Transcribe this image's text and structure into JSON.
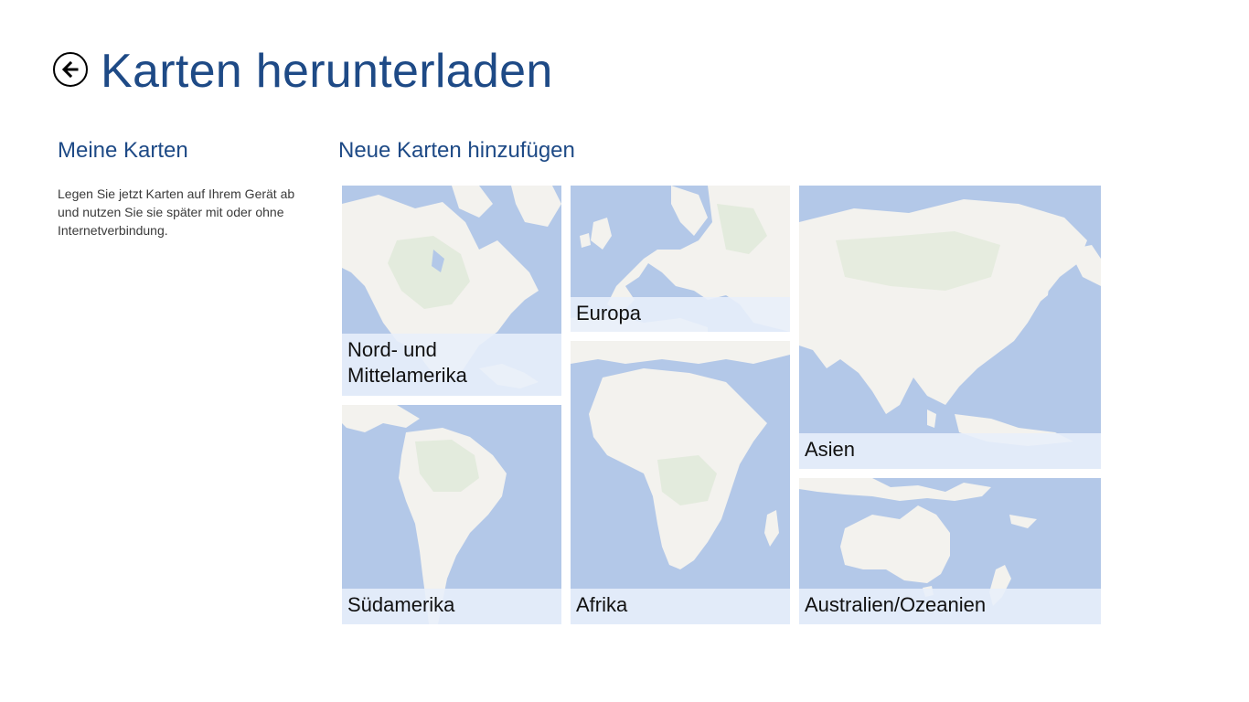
{
  "header": {
    "title": "Karten herunterladen",
    "back_icon": "back-arrow-icon"
  },
  "my_maps": {
    "heading": "Meine Karten",
    "description": "Legen Sie jetzt Karten auf Ihrem Gerät ab und nutzen Sie sie später mit oder ohne Internetverbindung."
  },
  "add_maps": {
    "heading": "Neue Karten hinzufügen",
    "regions": {
      "north_america": "Nord- und Mittelamerika",
      "europe": "Europa",
      "asia": "Asien",
      "south_america": "Südamerika",
      "africa": "Afrika",
      "australia": "Australien/Ozeanien"
    }
  },
  "colors": {
    "accent": "#1e4a86",
    "water": "#b3c8e8",
    "land": "#f3f2ee",
    "vegetation": "#dfe9d8",
    "label_band": "#e8effa"
  }
}
